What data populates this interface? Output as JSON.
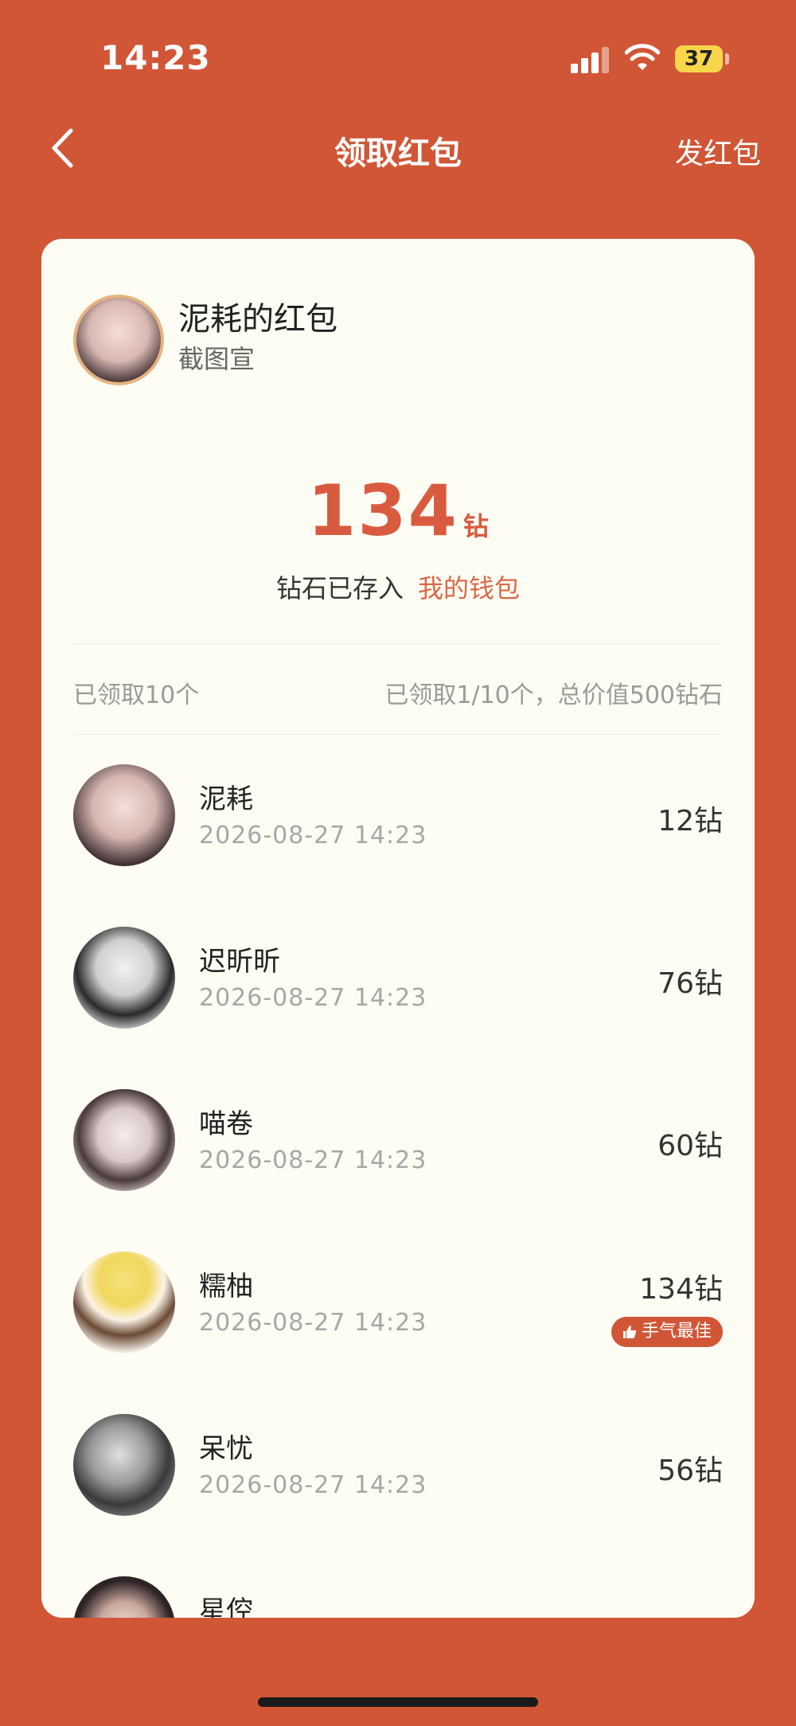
{
  "status_bar": {
    "time": "14:23",
    "battery": "37"
  },
  "nav": {
    "title": "领取红包",
    "right_action": "发红包"
  },
  "sender": {
    "title": "泥耗的红包",
    "subtitle": "截图宣"
  },
  "amount": {
    "value": "134",
    "unit": "钻"
  },
  "wallet": {
    "prefix": "钻石已存入",
    "link": "我的钱包"
  },
  "summary": {
    "left": "已领取10个",
    "right": "已领取1/10个，总价值500钻石"
  },
  "best_badge": "手气最佳",
  "records": [
    {
      "name": "泥耗",
      "time": "2026-08-27 14:23",
      "amount": "12钻",
      "best": false
    },
    {
      "name": "迟昕昕",
      "time": "2026-08-27 14:23",
      "amount": "76钻",
      "best": false
    },
    {
      "name": "喵卷",
      "time": "2026-08-27 14:23",
      "amount": "60钻",
      "best": false
    },
    {
      "name": "糯柚",
      "time": "2026-08-27 14:23",
      "amount": "134钻",
      "best": true
    },
    {
      "name": "呆忧",
      "time": "2026-08-27 14:23",
      "amount": "56钻",
      "best": false
    },
    {
      "name": "星倥",
      "time": "",
      "amount": "",
      "best": false
    }
  ],
  "colors": {
    "background": "#d05636",
    "card": "#fdfdf4",
    "accent": "#d95b3f"
  },
  "icons": [
    "cellular-signal-icon",
    "wifi-icon",
    "battery-icon",
    "back-chevron-icon",
    "thumbs-up-icon"
  ]
}
